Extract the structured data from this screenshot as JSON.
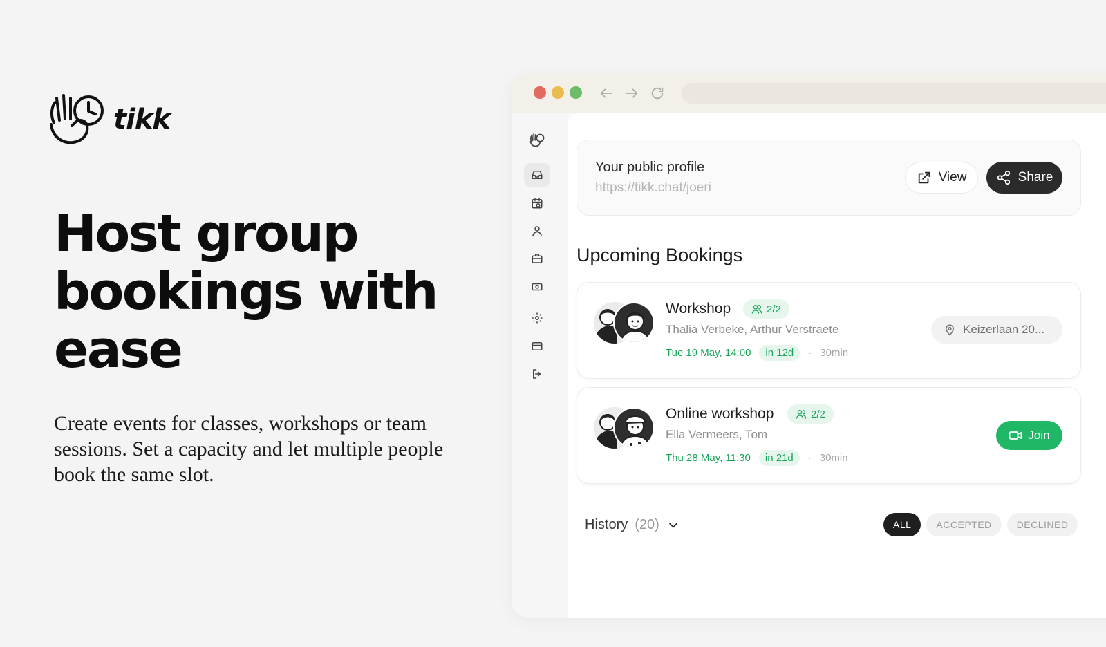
{
  "brand": {
    "name": "tikk"
  },
  "hero": {
    "headline": "Host group bookings with ease",
    "subtext": "Create events for classes, workshops or team sessions. Set a capacity and let multiple people book the same slot."
  },
  "browser": {
    "sidebar_icons": [
      "logo-icon",
      "inbox-icon",
      "calendar-clock-icon",
      "user-icon",
      "briefcase-icon",
      "money-icon",
      "gear-icon",
      "credit-card-icon",
      "logout-icon"
    ]
  },
  "profile": {
    "title": "Your public profile",
    "url": "https://tikk.chat/joeri",
    "view_label": "View",
    "share_label": "Share"
  },
  "upcoming": {
    "title": "Upcoming Bookings",
    "bookings": [
      {
        "title": "Workshop",
        "capacity": "2/2",
        "people": "Thalia Verbeke, Arthur Verstraete",
        "date": "Tue 19 May, 14:00",
        "relative": "in 12d",
        "separator": "·",
        "duration": "30min",
        "location": "Keizerlaan 20..."
      },
      {
        "title": "Online workshop",
        "capacity": "2/2",
        "people": "Ella Vermeers, Tom",
        "date": "Thu 28 May, 11:30",
        "relative": "in 21d",
        "separator": "·",
        "duration": "30min",
        "join_label": "Join"
      }
    ]
  },
  "history": {
    "label": "History",
    "count": "(20)",
    "filters": [
      "ALL",
      "ACCEPTED",
      "DECLINED"
    ]
  },
  "colors": {
    "accent_green": "#20b866",
    "dark": "#2b2b2b",
    "traffic_red": "#e26a5f",
    "traffic_yellow": "#e8bc4d",
    "traffic_green": "#6ebb6a"
  }
}
